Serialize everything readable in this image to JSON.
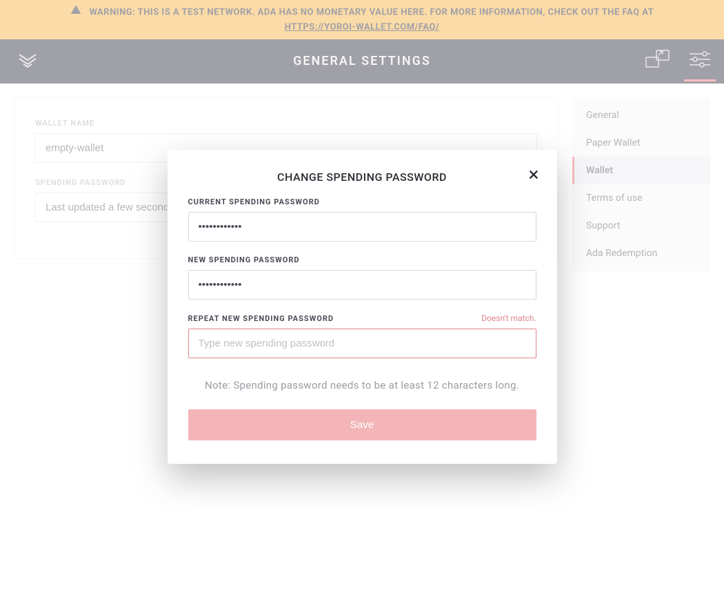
{
  "warning": {
    "text_prefix": "WARNING: THIS IS A TEST NETWORK. ADA HAS NO MONETARY VALUE HERE. FOR MORE INFORMATION, CHECK OUT THE FAQ AT",
    "link_text": "HTTPS://YOROI-WALLET.COM/FAQ/"
  },
  "header": {
    "title": "GENERAL SETTINGS"
  },
  "main": {
    "wallet_name_label": "WALLET NAME",
    "wallet_name_value": "empty-wallet",
    "spending_password_label": "SPENDING PASSWORD",
    "spending_password_value": "Last updated a few seconds ago"
  },
  "sidebar": {
    "items": [
      {
        "label": "General",
        "active": false
      },
      {
        "label": "Paper Wallet",
        "active": false
      },
      {
        "label": "Wallet",
        "active": true
      },
      {
        "label": "Terms of use",
        "active": false
      },
      {
        "label": "Support",
        "active": false
      },
      {
        "label": "Ada Redemption",
        "active": false
      }
    ]
  },
  "modal": {
    "title": "CHANGE SPENDING PASSWORD",
    "current_label": "CURRENT SPENDING PASSWORD",
    "current_value": "••••••••••••",
    "new_label": "NEW SPENDING PASSWORD",
    "new_value": "••••••••••••",
    "repeat_label": "REPEAT NEW SPENDING PASSWORD",
    "repeat_error": "Doesn't match.",
    "repeat_placeholder": "Type new spending password",
    "note": "Note: Spending password needs to be at least 12 characters long.",
    "save_label": "Save"
  },
  "colors": {
    "accent": "#eb5a62",
    "warning_bg": "#f5a623",
    "header_bg": "#121326"
  }
}
